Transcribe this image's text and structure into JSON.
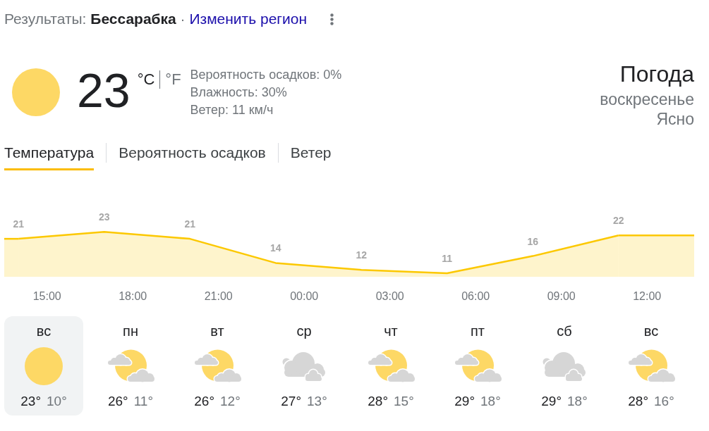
{
  "header": {
    "results_text": "Результаты: **Бессарабка** ·",
    "change_region_link": "Изменить регион"
  },
  "current": {
    "kind": "sunny",
    "temperature": "23",
    "units": [
      {
        "label": "°C",
        "selected": true
      },
      {
        "label": "°F",
        "selected": false
      }
    ],
    "details": [
      "Вероятность осадков: 0%",
      "Влажность: 30%",
      "Ветер: 11 км/ч"
    ]
  },
  "summary": {
    "title": "Погода",
    "day": "воскресенье",
    "condition": "Ясно"
  },
  "tabs": [
    {
      "label": "Температура",
      "selected": true
    },
    {
      "label": "Вероятность осадков",
      "selected": false
    },
    {
      "label": "Ветер",
      "selected": false
    }
  ],
  "hourly": {
    "chart_data": {
      "type": "area",
      "categories": [
        null,
        "15:00",
        null,
        null,
        "18:00",
        null,
        null,
        "21:00",
        null,
        null,
        "00:00",
        null,
        null,
        "03:00",
        null,
        null,
        "06:00",
        null,
        null,
        "09:00",
        null,
        null,
        "12:00",
        null
      ],
      "series": [
        {
          "color": "#fcc800",
          "values": [
            21,
            null,
            null,
            23,
            null,
            null,
            21,
            null,
            null,
            14,
            null,
            null,
            12,
            null,
            null,
            11,
            null,
            null,
            16,
            null,
            null,
            22,
            null,
            null
          ]
        }
      ],
      "data_labels": true
    }
  },
  "days": [
    {
      "day": "вс",
      "kind": "sunny",
      "high": "23°",
      "low": "10°",
      "selected": true
    },
    {
      "day": "пн",
      "kind": "partly_cloudy",
      "high": "26°",
      "low": "11°",
      "selected": false
    },
    {
      "day": "вт",
      "kind": "partly_cloudy",
      "high": "26°",
      "low": "12°",
      "selected": false
    },
    {
      "day": "ср",
      "kind": "cloudy",
      "high": "27°",
      "low": "13°",
      "selected": false
    },
    {
      "day": "чт",
      "kind": "partly_cloudy",
      "high": "28°",
      "low": "15°",
      "selected": false
    },
    {
      "day": "пт",
      "kind": "partly_cloudy",
      "high": "29°",
      "low": "18°",
      "selected": false
    },
    {
      "day": "сб",
      "kind": "cloudy",
      "high": "29°",
      "low": "18°",
      "selected": false
    },
    {
      "day": "вс",
      "kind": "partly_cloudy",
      "high": "28°",
      "low": "16°",
      "selected": false
    }
  ]
}
